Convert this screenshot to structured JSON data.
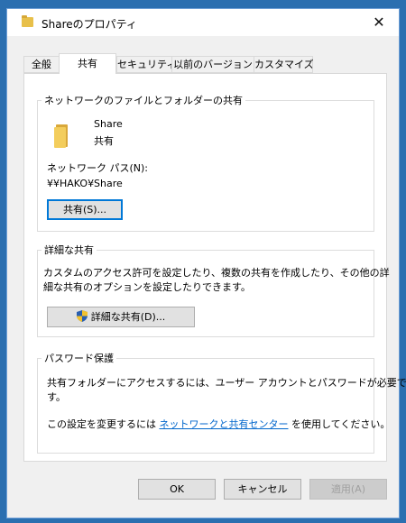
{
  "window": {
    "title": "Shareのプロパティ"
  },
  "tabs": [
    {
      "label": "全般"
    },
    {
      "label": "共有",
      "active": true
    },
    {
      "label": "セキュリティ"
    },
    {
      "label": "以前のバージョン"
    },
    {
      "label": "カスタマイズ"
    }
  ],
  "network_share": {
    "group_title": "ネットワークのファイルとフォルダーの共有",
    "folder_name": "Share",
    "folder_status": "共有",
    "path_label": "ネットワーク パス(N):",
    "path_value": "¥¥HAKO¥Share",
    "share_button": "共有(S)..."
  },
  "advanced_share": {
    "group_title": "詳細な共有",
    "description_line1": "カスタムのアクセス許可を設定したり、複数の共有を作成したり、その他の詳",
    "description_line2": "細な共有のオプションを設定したりできます。",
    "button": "詳細な共有(D)..."
  },
  "password_protection": {
    "group_title": "パスワード保護",
    "description_line1": "共有フォルダーにアクセスするには、ユーザー アカウントとパスワードが必要で",
    "description_line2": "す。",
    "change_prefix": "この設定を変更するには ",
    "link_text": "ネットワークと共有センター",
    "change_suffix": " を使用してください。"
  },
  "footer": {
    "ok": "OK",
    "cancel": "キャンセル",
    "apply": "適用(A)"
  },
  "icons": {
    "title": "folder-icon",
    "big_folder": "folder-icon",
    "advanced_button": "uac-shield-icon",
    "close": "close-icon"
  }
}
